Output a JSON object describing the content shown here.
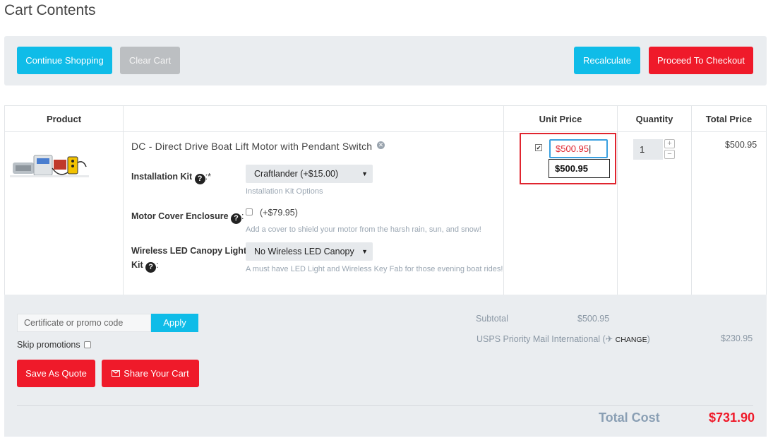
{
  "page": {
    "title": "Cart Contents"
  },
  "toolbar": {
    "continue_label": "Continue Shopping",
    "clear_label": "Clear Cart",
    "recalculate_label": "Recalculate",
    "checkout_label": "Proceed To Checkout"
  },
  "table": {
    "headers": {
      "product": "Product",
      "unit_price": "Unit Price",
      "quantity": "Quantity",
      "total_price": "Total Price"
    }
  },
  "item": {
    "name": "DC - Direct Drive Boat Lift Motor with Pendant Switch",
    "options": {
      "install_label": "Installation Kit",
      "install_suffix": ":*",
      "install_value": "Craftlander (+$15.00)",
      "install_hint": "Installation Kit Options",
      "cover_label": "Motor Cover Enclosure",
      "cover_suffix": ":",
      "cover_value": "(+$79.95)",
      "cover_hint": "Add a cover to shield your motor from the harsh rain, sun, and snow!",
      "led_label_line1": "Wireless LED Canopy Light",
      "led_label_line2": "Kit",
      "led_suffix": ":",
      "led_value": "No Wireless LED Canopy",
      "led_hint": "A must have LED Light and Wireless Key Fab for those evening boat rides!"
    },
    "unit_price_input": "$500.95",
    "unit_price_tooltip": "$500.95",
    "quantity": "1",
    "total_price": "$500.95"
  },
  "summary": {
    "promo_placeholder": "Certificate or promo code",
    "apply_label": "Apply",
    "skip_label": "Skip promotions",
    "save_quote_label": "Save As Quote",
    "share_label": "Share Your Cart",
    "subtotal_label": "Subtotal",
    "subtotal_value": "$500.95",
    "shipping_label": "USPS Priority Mail International (",
    "shipping_change": "CHANGE",
    "shipping_close": ")",
    "shipping_value": "$230.95",
    "total_label": "Total Cost",
    "total_value": "$731.90"
  },
  "colors": {
    "accent_blue": "#0fbce8",
    "accent_red": "#ef1a2a",
    "panel_gray": "#eaedf0"
  }
}
